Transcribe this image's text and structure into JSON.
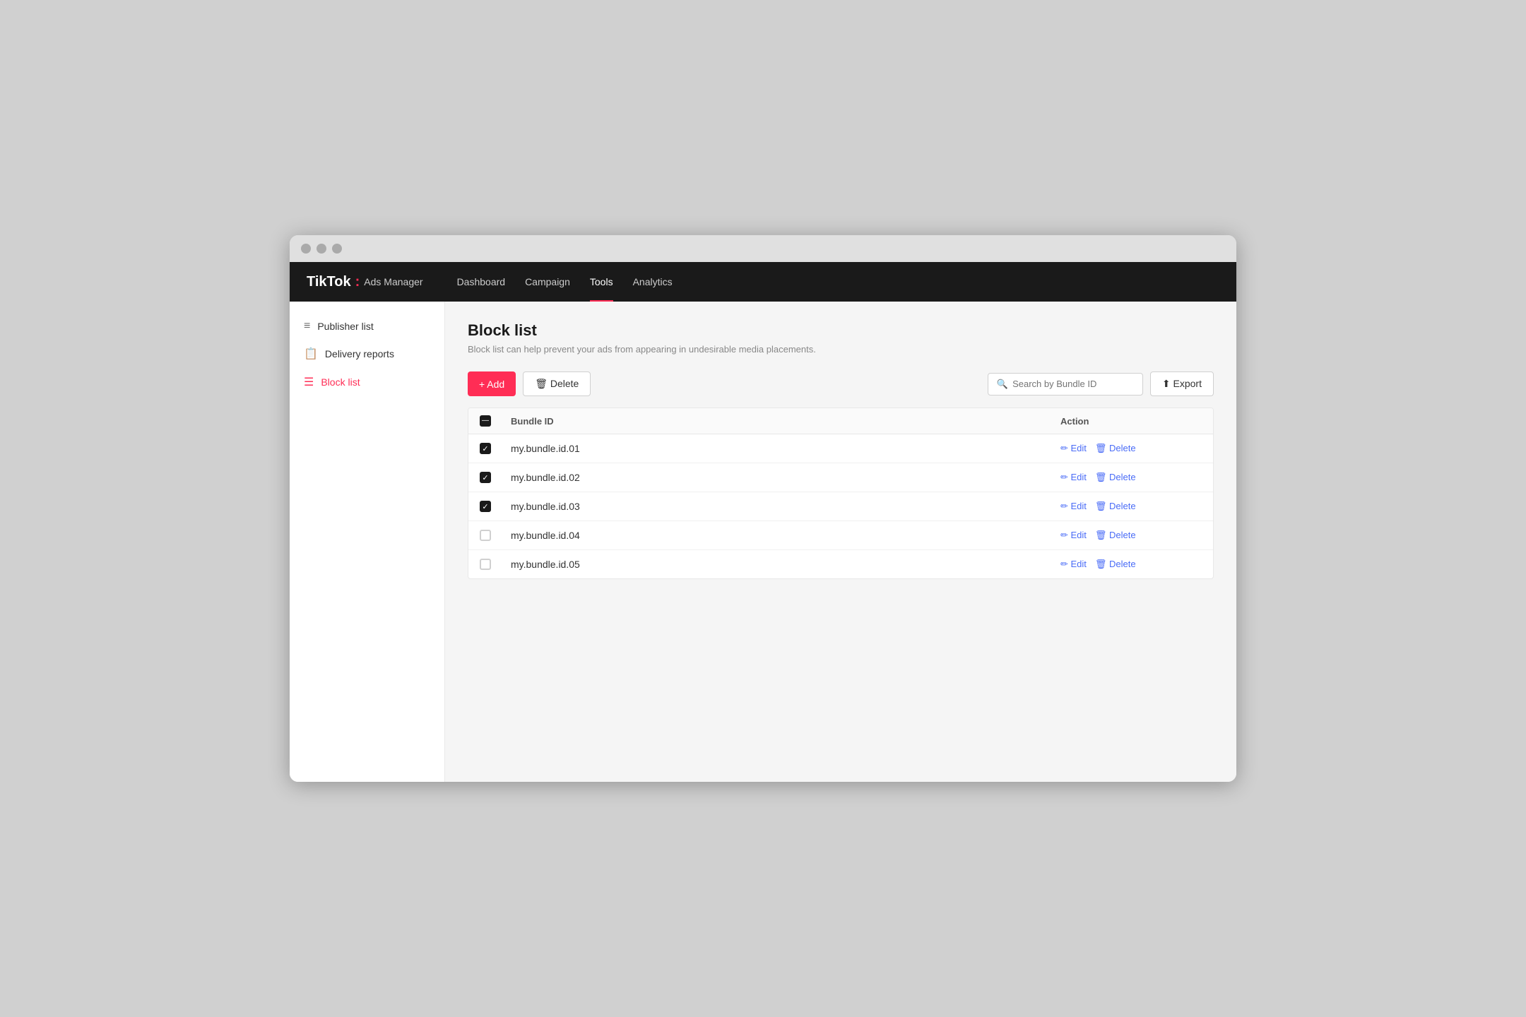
{
  "browser": {
    "btns": [
      "close",
      "minimize",
      "maximize"
    ]
  },
  "topnav": {
    "brand": "TikTok",
    "brand_sub": "Ads Manager",
    "links": [
      {
        "label": "Dashboard",
        "active": false
      },
      {
        "label": "Campaign",
        "active": false
      },
      {
        "label": "Tools",
        "active": true
      },
      {
        "label": "Analytics",
        "active": false
      }
    ]
  },
  "sidebar": {
    "items": [
      {
        "label": "Publisher list",
        "icon": "≡",
        "active": false
      },
      {
        "label": "Delivery reports",
        "icon": "📄",
        "active": false
      },
      {
        "label": "Block list",
        "icon": "☰",
        "active": true
      }
    ]
  },
  "main": {
    "title": "Block list",
    "subtitle": "Block list can help prevent your ads from appearing in undesirable media placements.",
    "toolbar": {
      "add_label": "+ Add",
      "delete_label": "🗑 Delete",
      "search_placeholder": "Search by Bundle ID",
      "export_label": "⬆ Export"
    },
    "table": {
      "columns": [
        "Bundle ID",
        "Action"
      ],
      "rows": [
        {
          "id": "my.bundle.id.01",
          "checked": true
        },
        {
          "id": "my.bundle.id.02",
          "checked": true
        },
        {
          "id": "my.bundle.id.03",
          "checked": true
        },
        {
          "id": "my.bundle.id.04",
          "checked": false
        },
        {
          "id": "my.bundle.id.05",
          "checked": false
        }
      ],
      "row_actions": {
        "edit_label": "✏ Edit",
        "delete_label": "🗑 Delete"
      }
    }
  },
  "colors": {
    "accent": "#ff2d55",
    "nav_bg": "#1a1a1a",
    "action_blue": "#4a6cf7"
  }
}
